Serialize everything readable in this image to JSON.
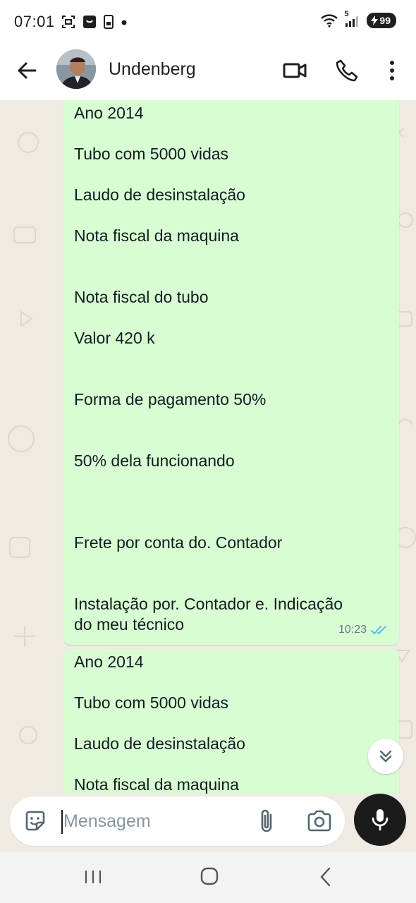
{
  "status_bar": {
    "time": "07:01",
    "battery_level": "99",
    "network_label": "5"
  },
  "header": {
    "contact_name": "Undenberg"
  },
  "messages": [
    {
      "lines": [
        "Ano 2014",
        "Tubo com 5000  vidas",
        "Laudo de desinstalação",
        "Nota fiscal  da maquina",
        "Nota fiscal do tubo",
        "Valor 420 k",
        "Forma de pagamento  50%",
        "50% dela funcionando",
        "Frete por conta do. Contador",
        "Instalação  por. Contador   e. Indicação",
        "do meu técnico"
      ],
      "time": "10:23",
      "status": "read"
    },
    {
      "lines": [
        "Ano 2014",
        "Tubo com 5000  vidas",
        "Laudo de desinstalação",
        "Nota fiscal  da maquina"
      ]
    }
  ],
  "composer": {
    "placeholder": "Mensagem"
  },
  "colors": {
    "bubble": "#d9fdd3",
    "chat_background": "#efeae2",
    "read_ticks": "#53bdeb"
  }
}
